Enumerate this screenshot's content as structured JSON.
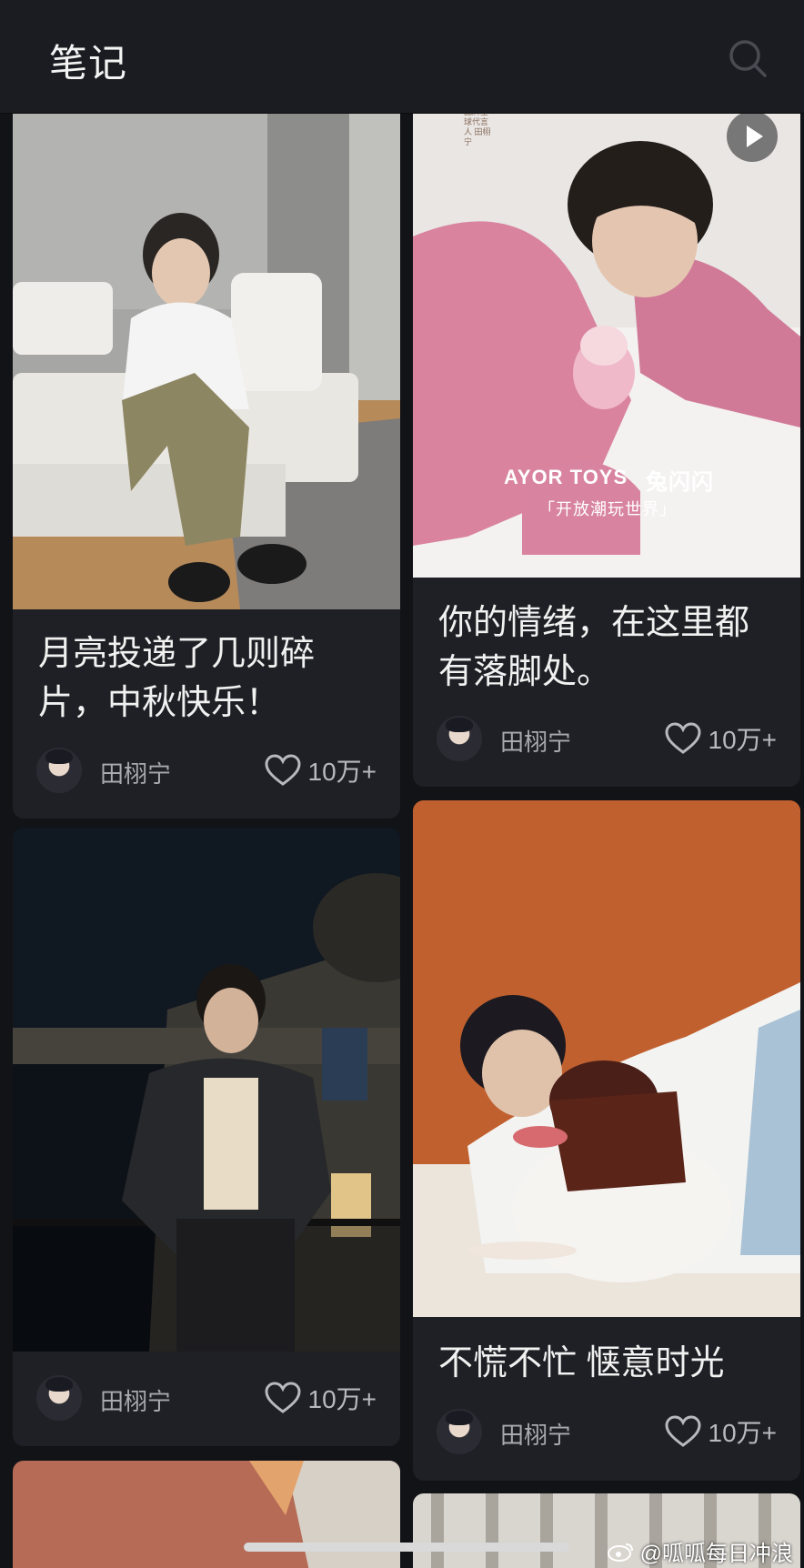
{
  "header": {
    "title": "笔记",
    "search_icon": "search-icon"
  },
  "notes": [
    {
      "title": "月亮投递了几则碎片，中秋快乐！",
      "author": "田栩宁",
      "likes": "10万+"
    },
    {
      "title": "你的情绪，在这里都有落脚处。",
      "author": "田栩宁",
      "likes": "10万+",
      "has_video": true,
      "overlay": {
        "brand": "AYOR TOYS",
        "product": "兔闪闪",
        "slogan": "「开放潮玩世界」",
        "side_text": "品牌全球代言人 田栩宁"
      }
    },
    {
      "title": "",
      "author": "田栩宁",
      "likes": "10万+"
    },
    {
      "title": "不慌不忙 惬意时光",
      "author": "田栩宁",
      "likes": "10万+"
    }
  ],
  "watermark": "@呱呱每日冲浪",
  "colors": {
    "background": "#121317",
    "card": "#1f2025",
    "header": "#1b1c21",
    "text_secondary": "#a9aab0"
  }
}
